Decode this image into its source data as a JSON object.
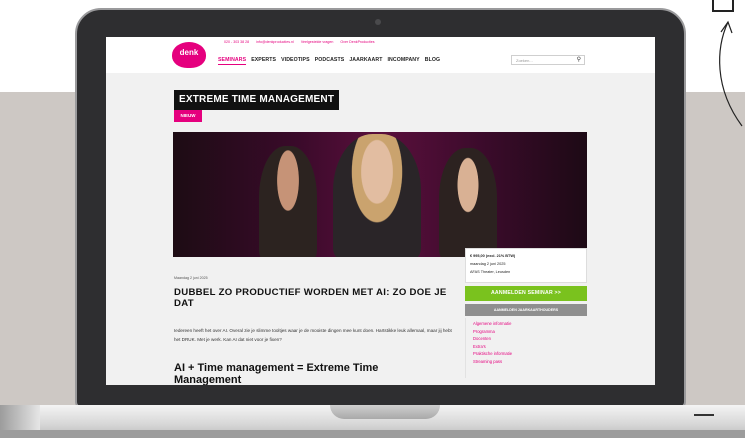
{
  "site": {
    "logo_text": "denk",
    "contact_links": [
      "020 - 303 38 28",
      "info@denkproducties.nl",
      "Veelgestelde vragen",
      "Over DenkProducties"
    ],
    "nav": [
      "SEMINARS",
      "EXPERTS",
      "VIDEOTIPS",
      "PODCASTS",
      "JAARKAART",
      "INCOMPANY",
      "BLOG"
    ],
    "nav_active": "SEMINARS",
    "search_placeholder": "Zoeken..."
  },
  "event": {
    "title": "EXTREME TIME MANAGEMENT",
    "tag": "NIEUW",
    "date_small": "Maandag 2 juni 2025",
    "headline": "DUBBEL ZO PRODUCTIEF WORDEN MET AI: ZO DOE JE DAT",
    "intro": "Iedereen heeft het over AI. Overal zie je slimme tooltjes waar je de mooiste dingen mee kunt doen. Hartstikke leuk allemaal, maar jij hebt het DRUK. Met je werk. Kan AI dat niet voor je fixen?",
    "section_heading": "AI + Time management = Extreme Time Management"
  },
  "booking": {
    "price": "€ 995,00 (excl. 21% BTW)",
    "date": "maandag 2 juni 2025",
    "location": "AFAS Theater, Leusden",
    "cta_primary": "AANMELDEN SEMINAR >>",
    "cta_secondary": "AANMELDEN JAARKAARTHOUDERS",
    "links": [
      "Algemene informatie",
      "Programma",
      "Docenten",
      "Extra's",
      "Praktische informatie",
      "Streaming pass"
    ]
  },
  "colors": {
    "brand": "#e5007e",
    "cta": "#7ac21e",
    "background": "#cdc8c4"
  }
}
